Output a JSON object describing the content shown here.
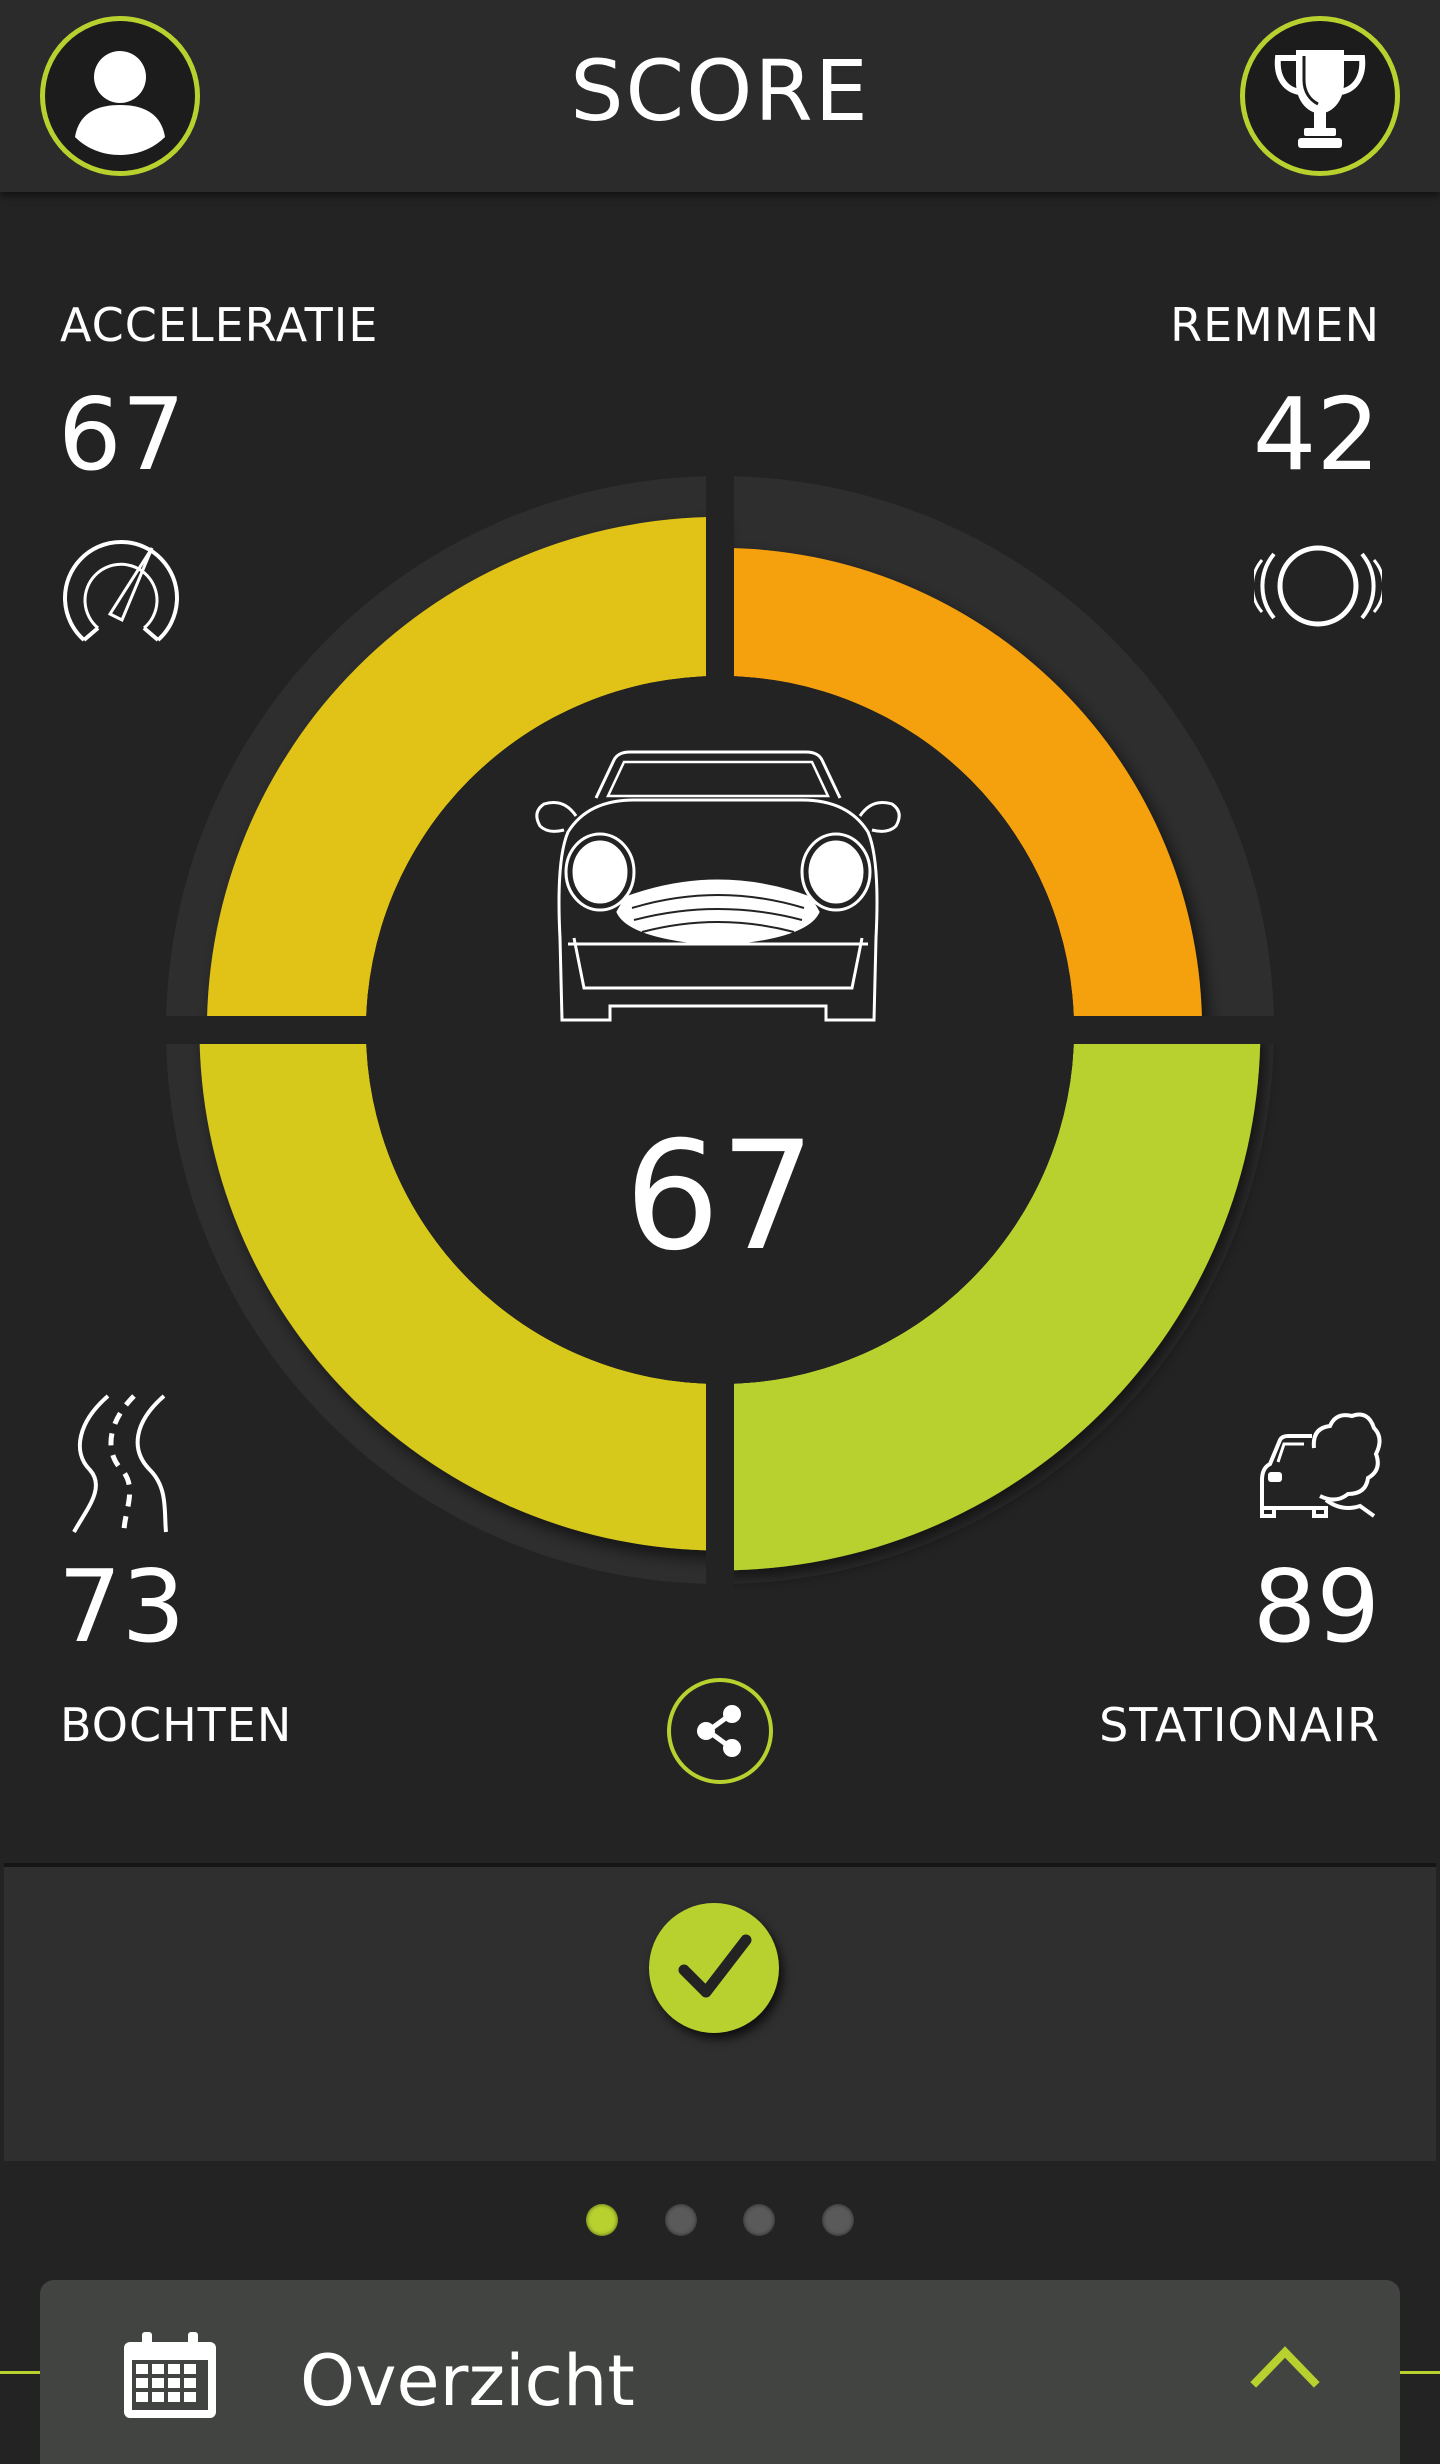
{
  "header": {
    "title": "SCORE",
    "profile_icon": "user-icon",
    "trophy_icon": "trophy-icon"
  },
  "scores": {
    "acceleratie": {
      "label": "ACCELERATIE",
      "value": "67",
      "icon": "speedometer-icon"
    },
    "remmen": {
      "label": "REMMEN",
      "value": "42",
      "icon": "brake-disc-icon"
    },
    "bochten": {
      "label": "BOCHTEN",
      "value": "73",
      "icon": "winding-road-icon"
    },
    "stationair": {
      "label": "STATIONAIR",
      "value": "89",
      "icon": "car-exhaust-icon"
    },
    "total": "67"
  },
  "gauge": {
    "levels": {
      "acceleratie": 67,
      "remmen": 42,
      "bochten": 73,
      "stationair": 89
    },
    "colors": {
      "acceleratie": "#e0c314",
      "remmen": "#f5a00f",
      "bochten": "#d7c81c",
      "stationair": "#b8d12f",
      "track": "#2e2e2e"
    }
  },
  "actions": {
    "share_icon": "share-icon",
    "confirm_icon": "checkmark-icon"
  },
  "pager": {
    "count": 4,
    "active": 1
  },
  "bottom": {
    "title": "Overzicht",
    "calendar_icon": "calendar-icon",
    "expand_icon": "chevron-up-icon"
  },
  "colors": {
    "accent": "#b8d12f",
    "background": "#232323",
    "header": "#2b2b2b"
  }
}
